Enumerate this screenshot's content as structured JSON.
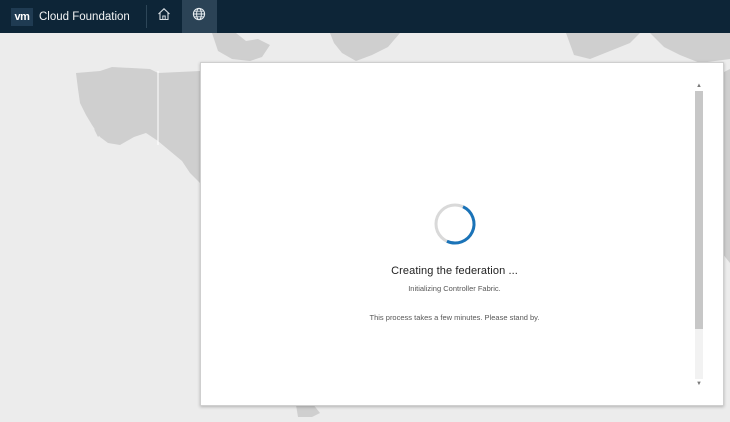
{
  "header": {
    "logo_text": "vm",
    "app_title": "Cloud Foundation",
    "nav": [
      {
        "icon": "home-icon",
        "active": false
      },
      {
        "icon": "globe-icon",
        "active": true
      }
    ]
  },
  "modal": {
    "title": "Creating the federation ...",
    "status": "Initializing Controller Fabric.",
    "note": "This process takes a few minutes. Please stand by."
  },
  "colors": {
    "header_bg": "#0d2537",
    "spinner_accent": "#1a73b8",
    "map_land": "#cfcfcf",
    "map_bg": "#ececec"
  }
}
